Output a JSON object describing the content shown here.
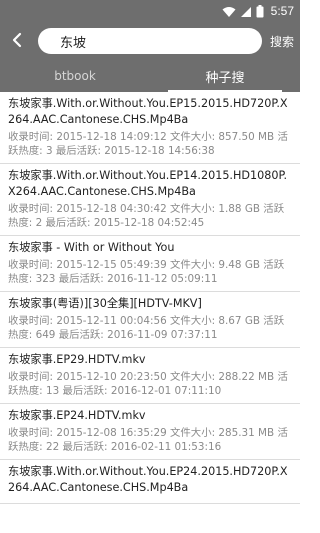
{
  "status_bar": {
    "time": "5:57"
  },
  "toolbar": {
    "search": {
      "value": "东坡",
      "placeholder": ""
    },
    "search_button": "搜索"
  },
  "tabs": [
    {
      "label": "btbook",
      "active": false
    },
    {
      "label": "种子搜",
      "active": true
    }
  ],
  "results": [
    {
      "title": "东坡家事.With.or.Without.You.EP15.2015.HD720P.X264.AAC.Cantonese.CHS.Mp4Ba",
      "meta": "收录时间: 2015-12-18 14:09:12 文件大小: 857.50 MB 活跃热度: 3 最后活跃: 2015-12-18 14:56:38"
    },
    {
      "title": "东坡家事.With.or.Without.You.EP14.2015.HD1080P.X264.AAC.Cantonese.CHS.Mp4Ba",
      "meta": "收录时间: 2015-12-18 04:30:42 文件大小: 1.88 GB 活跃热度: 2 最后活跃: 2015-12-18 04:52:45"
    },
    {
      "title": "东坡家事 - With or Without You",
      "meta": "收录时间: 2015-12-15 05:49:39 文件大小: 9.48 GB 活跃热度: 323 最后活跃: 2016-11-12 05:09:11"
    },
    {
      "title": "东坡家事(粤语)][30全集][HDTV-MKV]",
      "meta": "收录时间: 2015-12-11 00:04:56 文件大小: 8.67 GB 活跃热度: 649 最后活跃: 2016-11-09 07:37:11"
    },
    {
      "title": "东坡家事.EP29.HDTV.mkv",
      "meta": "收录时间: 2015-12-10 20:23:50 文件大小: 288.22 MB 活跃热度: 13 最后活跃: 2016-12-01 07:11:10"
    },
    {
      "title": "东坡家事.EP24.HDTV.mkv",
      "meta": "收录时间: 2015-12-08 16:35:29 文件大小: 285.31 MB 活跃热度: 22 最后活跃: 2016-02-11 01:53:16"
    },
    {
      "title": "东坡家事.With.or.Without.You.EP24.2015.HD720P.X264.AAC.Cantonese.CHS.Mp4Ba",
      "meta": ""
    }
  ],
  "icons": {
    "wifi": "wifi-icon",
    "signal": "signal-icon",
    "battery": "battery-icon",
    "back": "arrow-left-icon"
  },
  "colors": {
    "header_bg": "#6e6e6e",
    "text_primary": "#222222",
    "text_secondary": "#8a8a8a",
    "divider": "#dcdcdc"
  }
}
